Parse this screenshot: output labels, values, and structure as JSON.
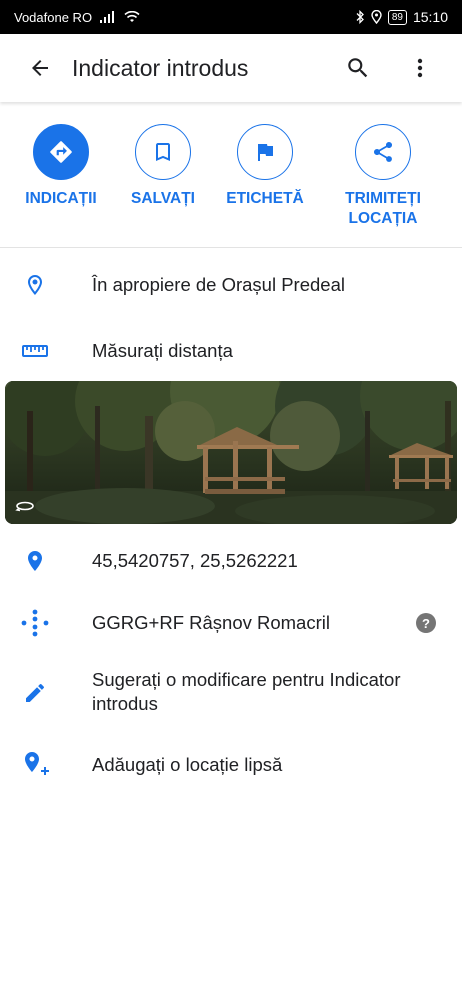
{
  "status_bar": {
    "carrier": "Vodafone RO",
    "battery": "89",
    "time": "15:10"
  },
  "app_bar": {
    "title": "Indicator introdus"
  },
  "actions": [
    {
      "label_line1": "INDICAȚII",
      "label_line2": ""
    },
    {
      "label_line1": "SALVAȚI",
      "label_line2": ""
    },
    {
      "label_line1": "ETICHETĂ",
      "label_line2": ""
    },
    {
      "label_line1": "TRIMITEȚI",
      "label_line2": "LOCAȚIA"
    }
  ],
  "rows": {
    "nearby": "În apropiere de Orașul Predeal",
    "measure": "Măsurați distanța",
    "coordinates": "45,5420757, 25,5262221",
    "plus_code": "GGRG+RF Râșnov Romacril",
    "suggest_line1": "Sugerați o modificare pentru Indicator",
    "suggest_line2": "introdus",
    "add_place": "Adăugați o locație lipsă"
  },
  "colors": {
    "accent": "#1a73e8",
    "text": "#202124",
    "icon_grey": "#757575"
  },
  "icons": [
    "back-arrow",
    "search",
    "more-vert",
    "directions",
    "bookmark",
    "flag",
    "share",
    "pin-outline",
    "ruler",
    "panorama-360",
    "pin",
    "plus-code",
    "edit",
    "add-location",
    "help"
  ]
}
